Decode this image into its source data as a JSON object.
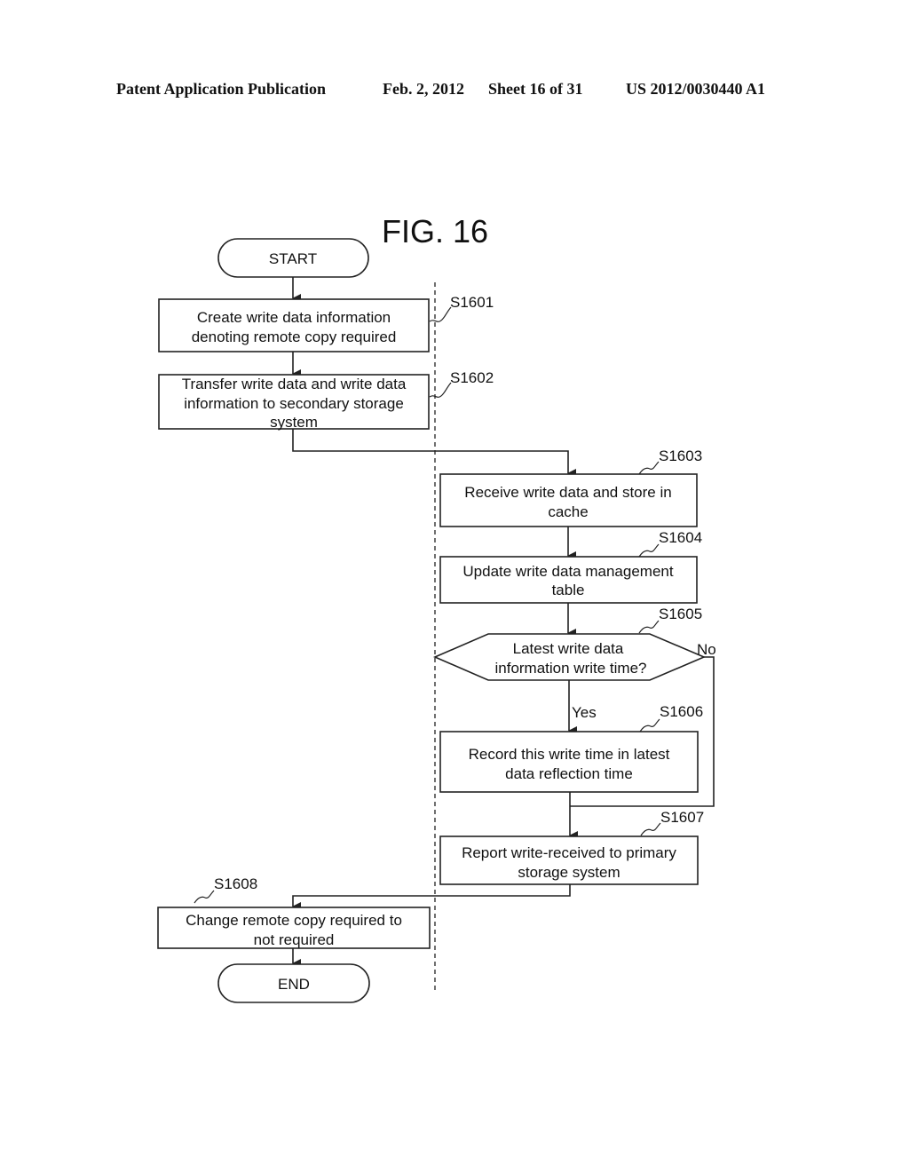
{
  "header": {
    "publication": "Patent Application Publication",
    "date": "Feb. 2, 2012",
    "sheet": "Sheet 16 of 31",
    "number": "US 2012/0030440 A1"
  },
  "figure": {
    "title": "FIG. 16",
    "start": "START",
    "end": "END",
    "steps": {
      "s1601": {
        "label": "S1601",
        "lines": [
          "Create write data information",
          "denoting remote copy required"
        ]
      },
      "s1602": {
        "label": "S1602",
        "lines": [
          "Transfer write data and write data",
          "information to secondary storage",
          "system"
        ]
      },
      "s1603": {
        "label": "S1603",
        "lines": [
          "Receive write data and store in",
          "cache"
        ]
      },
      "s1604": {
        "label": "S1604",
        "lines": [
          "Update write data management",
          "table"
        ]
      },
      "s1605": {
        "label": "S1605",
        "lines": [
          "Latest write data",
          "information write time?"
        ],
        "yes": "Yes",
        "no": "No"
      },
      "s1606": {
        "label": "S1606",
        "lines": [
          "Record this write time in latest",
          "data reflection time"
        ]
      },
      "s1607": {
        "label": "S1607",
        "lines": [
          "Report write-received to primary",
          "storage system"
        ]
      },
      "s1608": {
        "label": "S1608",
        "lines": [
          "Change remote copy required to",
          "not required"
        ]
      }
    }
  }
}
